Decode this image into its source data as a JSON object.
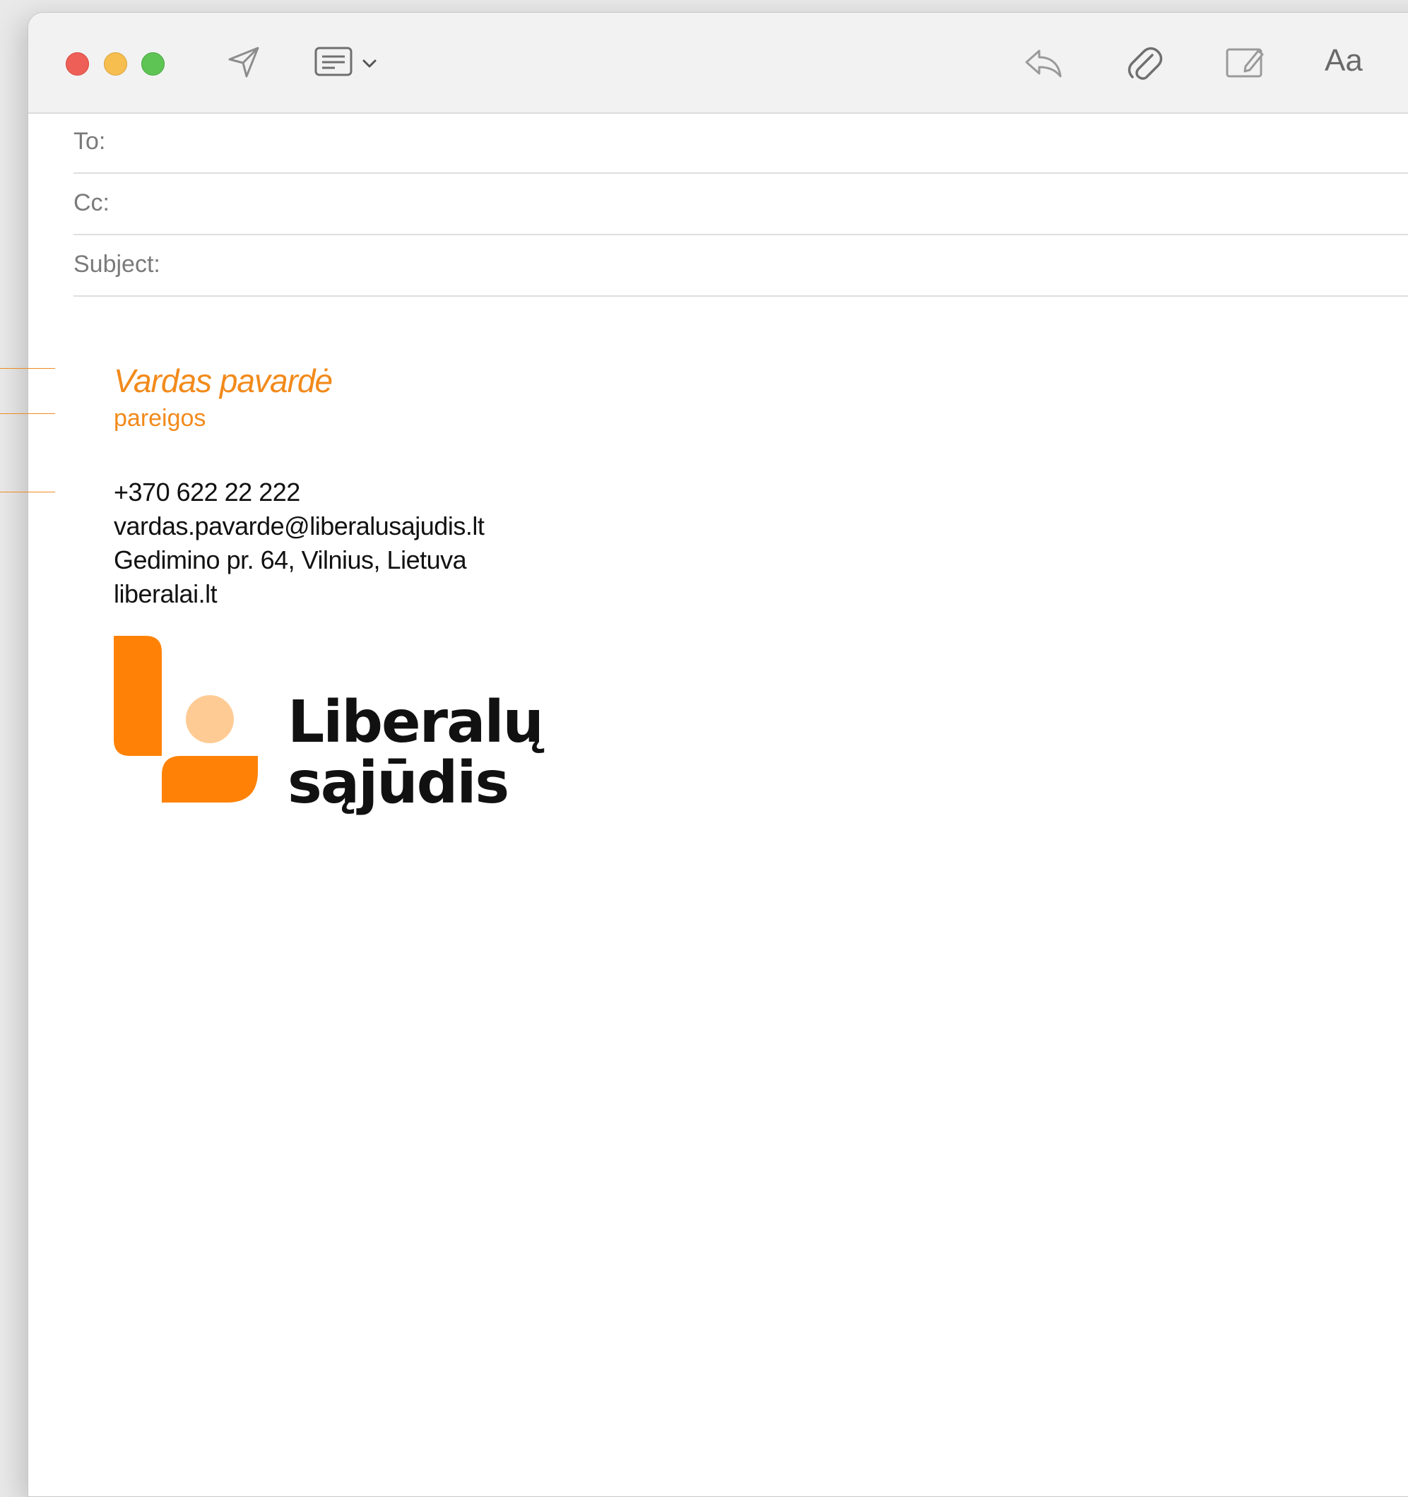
{
  "window": {
    "buttons": {
      "close": "close-button",
      "minimize": "minimize-button",
      "zoom": "zoom-button"
    },
    "colors": {
      "close": "#ee5f57",
      "minimize": "#f5be4f",
      "zoom": "#5ec454"
    }
  },
  "toolbar": {
    "send_icon": "paper-plane-icon",
    "header_fields_icon": "list-window-icon",
    "header_fields_chevron": "chevron-down-icon",
    "reply_icon": "reply-arrow-icon",
    "attach_icon": "paperclip-icon",
    "markup_icon": "markup-pencil-icon",
    "font_label": "Aa"
  },
  "headers": {
    "to": {
      "label": "To:",
      "value": ""
    },
    "cc": {
      "label": "Cc:",
      "value": ""
    },
    "subject": {
      "label": "Subject:",
      "value": ""
    }
  },
  "signature": {
    "name": "Vardas pavardė",
    "role": "pareigos",
    "phone": "+370 622 22 222",
    "email": "vardas.pavarde@liberalusajudis.lt",
    "address": "Gedimino pr. 64, Vilnius, Lietuva",
    "website": "liberalai.lt",
    "accent_color": "#f28a1b",
    "logo": {
      "line1": "Liberalų",
      "line2": "sąjūdis",
      "colors": {
        "primary": "#ff8207",
        "light": "#ffcb94"
      }
    }
  }
}
